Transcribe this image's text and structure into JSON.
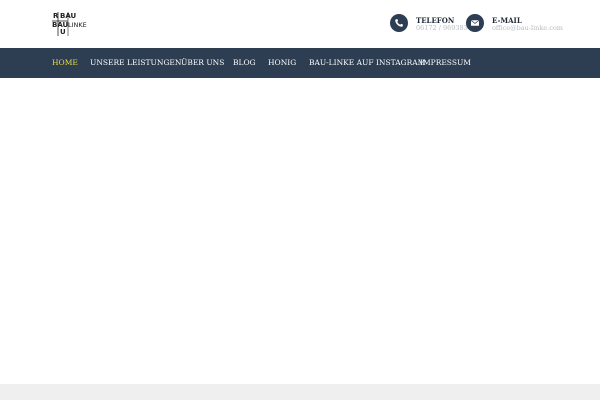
{
  "logo": {
    "letters_bau_top": "BAU",
    "letters_bau_left": "BAU",
    "letter_r": "R",
    "letter_u": "U",
    "letter_linke": "LINKE"
  },
  "contacts": {
    "phone": {
      "icon": "phone-icon",
      "label": "TELEFON",
      "value": "06172 / 969383"
    },
    "email": {
      "icon": "envelope-icon",
      "label": "E-MAIL",
      "value": "office@bau-linke.com"
    }
  },
  "nav": {
    "items": [
      {
        "label": "HOME",
        "active": true
      },
      {
        "label": "UNSERE LEISTUNGEN"
      },
      {
        "label": "ÜBER UNS"
      },
      {
        "label": "BLOG"
      },
      {
        "label": "HONIG"
      },
      {
        "label": "BAU-LINKE AUF INSTAGRAM"
      },
      {
        "label": "IMPRESSUM"
      }
    ]
  },
  "colors": {
    "nav_bg": "#2d3d52",
    "nav_active": "#e8df3b",
    "nav_text": "#ffffff",
    "contact_value": "#b7bcc3"
  }
}
